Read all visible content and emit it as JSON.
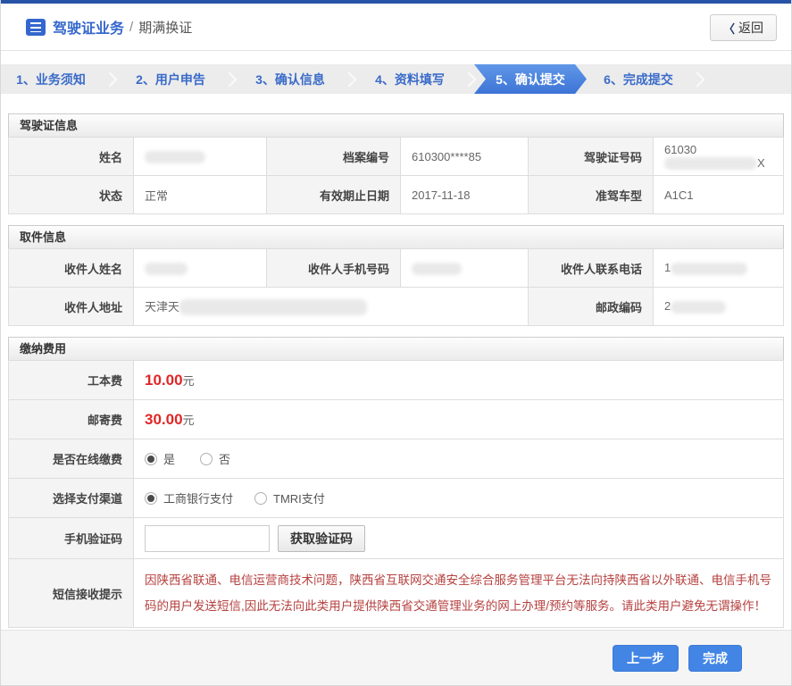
{
  "theme": {
    "topbar_blue": "#2653a6",
    "title_blue": "#3466cc",
    "active_step_blue": "#4179d8",
    "button_blue": "#4285e5",
    "price_red": "#e02626",
    "notice_red": "#b5413f"
  },
  "header": {
    "title_primary": "驾驶证业务",
    "title_separator": "/",
    "title_secondary": "期满换证",
    "back_chevron": "〈",
    "back_label": "返回"
  },
  "steps": [
    {
      "label": "1、业务须知"
    },
    {
      "label": "2、用户申告"
    },
    {
      "label": "3、确认信息"
    },
    {
      "label": "4、资料填写"
    },
    {
      "label": "5、确认提交"
    },
    {
      "label": "6、完成提交"
    }
  ],
  "active_step": "5、确认提交",
  "license": {
    "title": "驾驶证信息",
    "name_label": "姓名",
    "file_no_label": "档案编号",
    "file_no_value": "610300****85",
    "license_no_label": "驾驶证号码",
    "license_no_prefix": "61030",
    "license_no_suffix": "X",
    "status_label": "状态",
    "status_value": "正常",
    "expiry_label": "有效期止日期",
    "expiry_value": "2017-11-18",
    "vehicle_label": "准驾车型",
    "vehicle_value": "A1C1"
  },
  "pickup": {
    "title": "取件信息",
    "recipient_name_label": "收件人姓名",
    "mobile_label": "收件人手机号码",
    "phone_label": "收件人联系电话",
    "phone_prefix": "1",
    "address_label": "收件人地址",
    "address_prefix": "天津天",
    "postcode_label": "邮政编码",
    "postcode_prefix": "2"
  },
  "fees": {
    "title": "缴纳费用",
    "production_fee_label": "工本费",
    "production_fee_value": "10.00",
    "mailing_fee_label": "邮寄费",
    "mailing_fee_value": "30.00",
    "currency": "元",
    "online_payment_label": "是否在线缴费",
    "online_yes": "是",
    "online_no": "否",
    "channel_label": "选择支付渠道",
    "channel_icbc": "工商银行支付",
    "channel_tmri": "TMRI支付",
    "sms_code_label": "手机验证码",
    "get_code_button": "获取验证码",
    "sms_notice_label": "短信接收提示",
    "sms_notice_text": "因陕西省联通、电信运营商技术问题，陕西省互联网交通安全综合服务管理平台无法向持陕西省以外联通、电信手机号码的用户发送短信,因此无法向此类用户提供陕西省交通管理业务的网上办理/预约等服务。请此类用户避免无谓操作！"
  },
  "footer": {
    "prev_button": "上一步",
    "finish_button": "完成"
  }
}
